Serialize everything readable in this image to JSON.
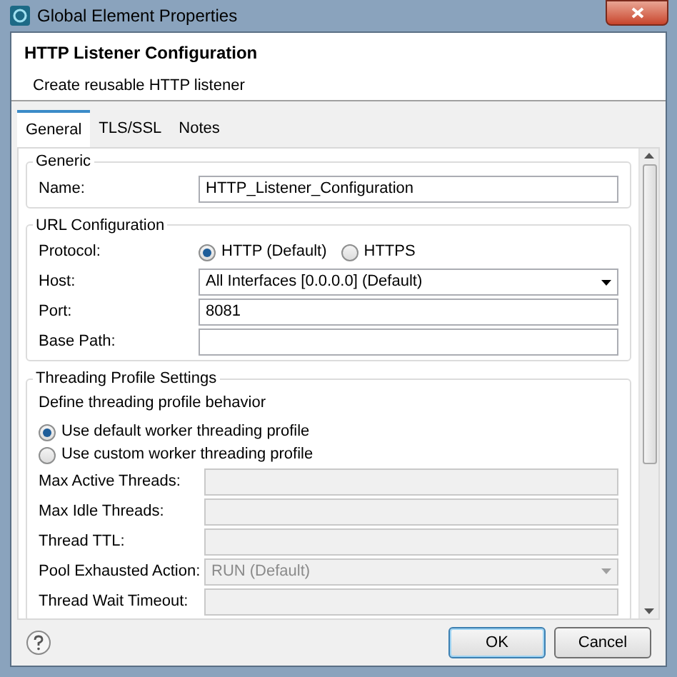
{
  "window": {
    "title": "Global Element Properties"
  },
  "header": {
    "title": "HTTP Listener Configuration",
    "subtitle": "Create reusable HTTP listener"
  },
  "tabs": [
    {
      "label": "General",
      "selected": true
    },
    {
      "label": "TLS/SSL",
      "selected": false
    },
    {
      "label": "Notes",
      "selected": false
    }
  ],
  "sections": [
    {
      "title": "Generic",
      "rows": [
        {
          "kind": "text",
          "label": "Name:",
          "value": "HTTP_Listener_Configuration",
          "disabled": false
        }
      ]
    },
    {
      "title": "URL Configuration",
      "rows": [
        {
          "kind": "radio",
          "label": "Protocol:",
          "options": [
            {
              "label": "HTTP (Default)",
              "selected": true
            },
            {
              "label": "HTTPS",
              "selected": false
            }
          ]
        },
        {
          "kind": "select",
          "label": "Host:",
          "value": "All Interfaces [0.0.0.0] (Default)",
          "disabled": false
        },
        {
          "kind": "text",
          "label": "Port:",
          "value": "8081",
          "disabled": false
        },
        {
          "kind": "text",
          "label": "Base Path:",
          "disabled": false
        }
      ]
    },
    {
      "title": "Threading Profile Settings",
      "description": "Define threading profile behavior",
      "options": [
        {
          "label": "Use default worker threading profile",
          "selected": true
        },
        {
          "label": "Use custom worker threading profile",
          "selected": false
        }
      ],
      "rows": [
        {
          "kind": "text",
          "label": "Max Active Threads:",
          "disabled": true
        },
        {
          "kind": "text",
          "label": "Max Idle Threads:",
          "disabled": true
        },
        {
          "kind": "text",
          "label": "Thread TTL:",
          "disabled": true
        },
        {
          "kind": "select",
          "label": "Pool Exhausted Action:",
          "value": "RUN (Default)",
          "disabled": true
        },
        {
          "kind": "text",
          "label": "Thread Wait Timeout:",
          "disabled": true
        }
      ]
    }
  ],
  "buttons": [
    {
      "label": "OK",
      "default": true
    },
    {
      "label": "Cancel",
      "default": false
    }
  ]
}
